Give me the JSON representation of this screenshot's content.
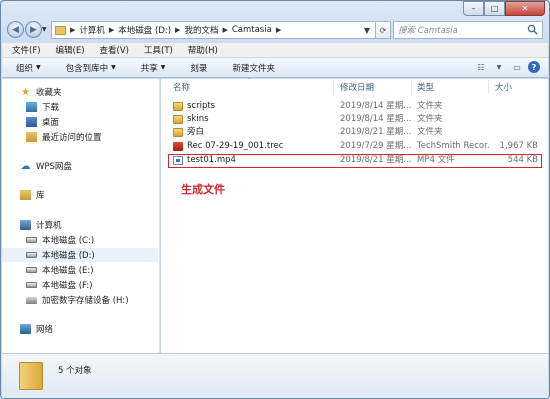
{
  "window": {
    "close_symbol": "✕",
    "min_symbol": "–",
    "max_symbol": "□"
  },
  "address": {
    "crumbs": [
      "计算机",
      "本地磁盘 (D:)",
      "我的文档",
      "Camtasia"
    ],
    "search_placeholder": "搜索 Camtasia",
    "back_symbol": "◀",
    "forward_symbol": "▶",
    "dropdown_symbol": "▼",
    "refresh_symbol": "⟳"
  },
  "menu": [
    "文件(F)",
    "编辑(E)",
    "查看(V)",
    "工具(T)",
    "帮助(H)"
  ],
  "commands": [
    {
      "label": "组织",
      "has_arrow": true
    },
    {
      "label": "包含到库中",
      "has_arrow": true
    },
    {
      "label": "共享",
      "has_arrow": true
    },
    {
      "label": "刻录",
      "has_arrow": false
    },
    {
      "label": "新建文件夹",
      "has_arrow": false
    }
  ],
  "nav": {
    "favorites": "收藏夹",
    "downloads": "下载",
    "desktop": "桌面",
    "recent": "最近访问的位置",
    "wps": "WPS网盘",
    "library": "库",
    "computer": "计算机",
    "drive_c": "本地磁盘 (C:)",
    "drive_d": "本地磁盘 (D:)",
    "drive_e": "本地磁盘 (E:)",
    "drive_f": "本地磁盘 (F:)",
    "encrypted": "加密数字存储设备 (H:)",
    "network": "网络"
  },
  "columns": {
    "name": "名称",
    "modified": "修改日期",
    "type": "类型",
    "size": "大小"
  },
  "files": [
    {
      "name": "scripts",
      "modified": "2019/8/14 星期...",
      "type": "文件夹",
      "size": "",
      "icon": "folder-icon"
    },
    {
      "name": "skins",
      "modified": "2019/8/14 星期...",
      "type": "文件夹",
      "size": "",
      "icon": "folder-icon"
    },
    {
      "name": "旁白",
      "modified": "2019/8/21 星期...",
      "type": "文件夹",
      "size": "",
      "icon": "folder-icon"
    },
    {
      "name": "Rec 07-29-19_001.trec",
      "modified": "2019/7/29 星期...",
      "type": "TechSmith Recor...",
      "size": "1,967 KB",
      "icon": "trec-file-icon"
    },
    {
      "name": "test01.mp4",
      "modified": "2019/8/21 星期...",
      "type": "MP4 文件",
      "size": "544 KB",
      "icon": "mp4-file-icon"
    }
  ],
  "annotation": "生成文件",
  "status": {
    "count": "5 个对象"
  },
  "colors": {
    "highlight": "#d3272f",
    "accent": "#2f6db8"
  }
}
